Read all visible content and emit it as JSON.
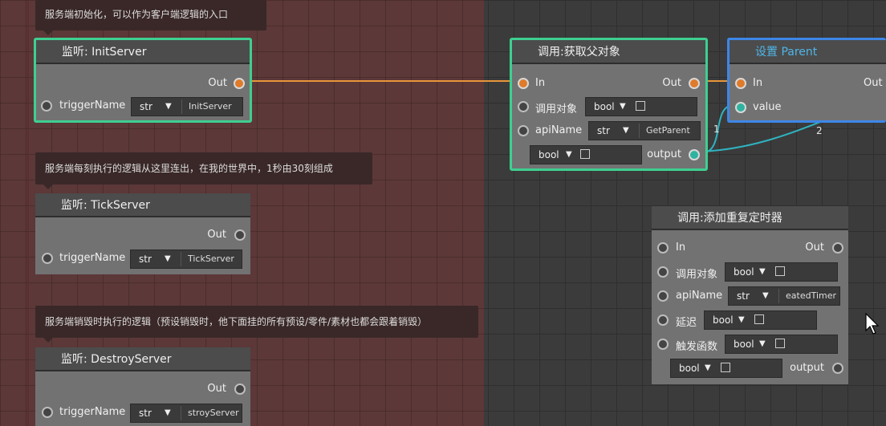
{
  "comments": {
    "init": "服务端初始化，可以作为客户端逻辑的入口",
    "tick": "服务端每刻执行的逻辑从这里连出，在我的世界中，1秒由30刻组成",
    "destroy": "服务端销毁时执行的逻辑（预设销毁时，他下面挂的所有预设/零件/素材也都会跟着销毁）"
  },
  "nodes": {
    "init_server": {
      "title": "监听: InitServer",
      "out": "Out",
      "param": "triggerName",
      "type": "str",
      "value": "InitServer"
    },
    "tick_server": {
      "title": "监听: TickServer",
      "out": "Out",
      "param": "triggerName",
      "type": "str",
      "value": "TickServer"
    },
    "destroy_server": {
      "title": "监听: DestroyServer",
      "out": "Out",
      "param": "triggerName",
      "type": "str",
      "value": "stroyServer"
    },
    "get_parent": {
      "title": "调用:获取父对象",
      "in": "In",
      "out": "Out",
      "target": "调用对象",
      "target_type": "bool",
      "api": "apiName",
      "api_type": "str",
      "api_value": "GetParent",
      "extra_type": "bool",
      "output": "output"
    },
    "set_parent": {
      "title": "设置 Parent",
      "in": "In",
      "out": "Out",
      "value": "value"
    },
    "add_timer": {
      "title": "调用:添加重复定时器",
      "in": "In",
      "out": "Out",
      "target": "调用对象",
      "target_type": "bool",
      "api": "apiName",
      "api_type": "str",
      "api_value": "eatedTimer",
      "delay": "延迟",
      "delay_type": "bool",
      "func": "触发函数",
      "func_type": "bool",
      "extra_type": "bool",
      "output": "output"
    }
  },
  "wires": {
    "label_1": "1",
    "label_2": "2"
  },
  "colors": {
    "exec_wire": "#e8963a",
    "data_wire": "#2fb3c0",
    "selected_green": "#3ecf91",
    "selected_blue": "#3d86e8"
  },
  "icons": {
    "arrow": "▼",
    "cursor": "mouse-pointer-icon"
  }
}
